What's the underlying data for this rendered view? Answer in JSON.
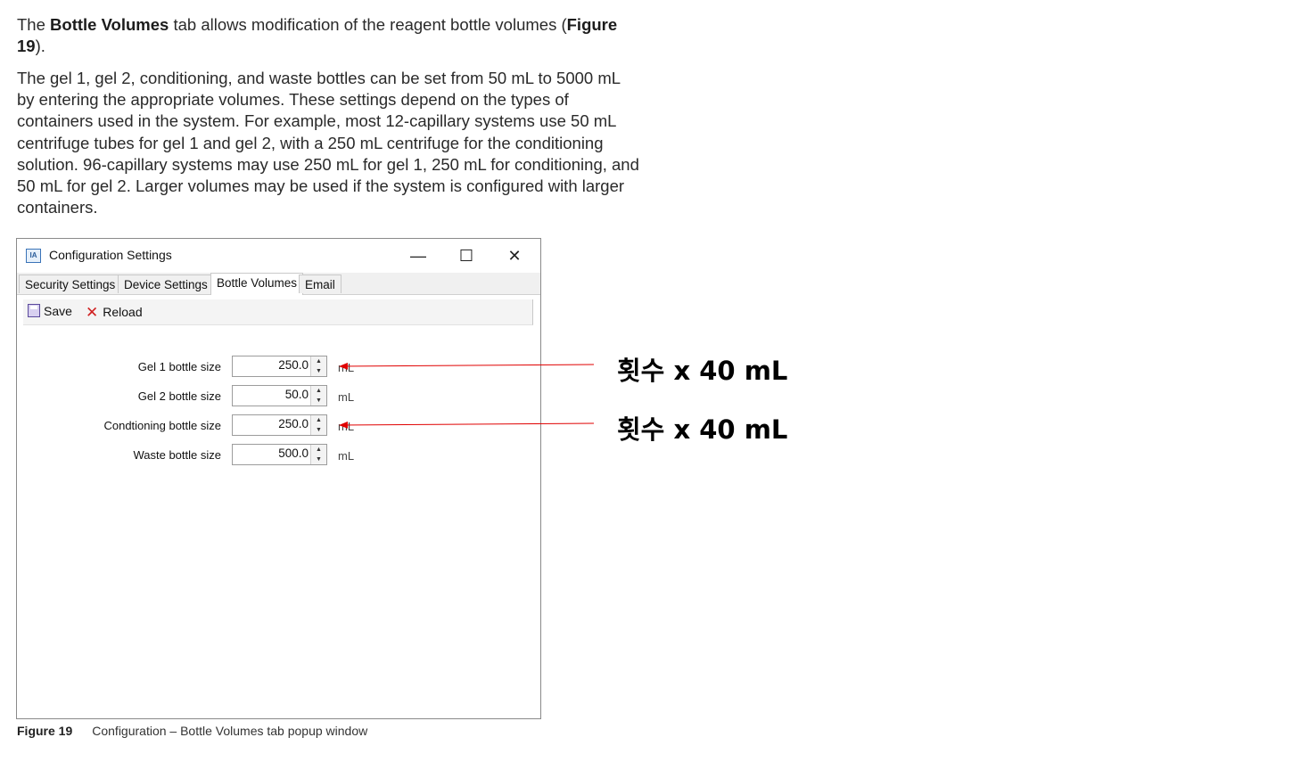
{
  "doc": {
    "p1_pre": "The ",
    "p1_bold": "Bottle Volumes",
    "p1_mid": " tab allows modification of the reagent bottle volumes (",
    "p1_fig": "Figure 19",
    "p1_post": ").",
    "p2": "The gel 1, gel 2, conditioning, and waste bottles can be set from 50 mL to 5000 mL by entering the appropriate volumes. These settings depend on the types of containers used in the system. For example, most 12-capillary systems use 50 mL centrifuge tubes for gel 1 and gel 2, with a 250 mL centrifuge for the conditioning solution. 96-capillary systems may use 250 mL for gel 1, 250 mL for conditioning, and 50 mL for gel 2. Larger volumes may be used if the system is configured with larger containers."
  },
  "window": {
    "title": "Configuration Settings",
    "icon_text": "IA",
    "min_glyph": "—",
    "max_glyph": "☐",
    "close_glyph": "✕"
  },
  "tabs": [
    "Security Settings",
    "Device Settings",
    "Bottle Volumes",
    "Email"
  ],
  "active_tab": "Bottle Volumes",
  "toolbar": {
    "save_label": "Save",
    "reload_label": "Reload"
  },
  "fields": [
    {
      "label": "Gel 1 bottle size",
      "value": "250.0",
      "unit": "mL"
    },
    {
      "label": "Gel 2 bottle size",
      "value": "50.0",
      "unit": "mL"
    },
    {
      "label": "Condtioning bottle size",
      "value": "250.0",
      "unit": "mL"
    },
    {
      "label": "Waste bottle size",
      "value": "500.0",
      "unit": "mL"
    }
  ],
  "caption": {
    "figure": "Figure 19",
    "text": "Configuration – Bottle Volumes tab popup window"
  },
  "annotations": [
    {
      "text": "횟수 x 40 mL"
    },
    {
      "text": "횟수 x 40 mL"
    }
  ],
  "colors": {
    "arrow": "#e00000",
    "accent": "#3a73b8"
  }
}
